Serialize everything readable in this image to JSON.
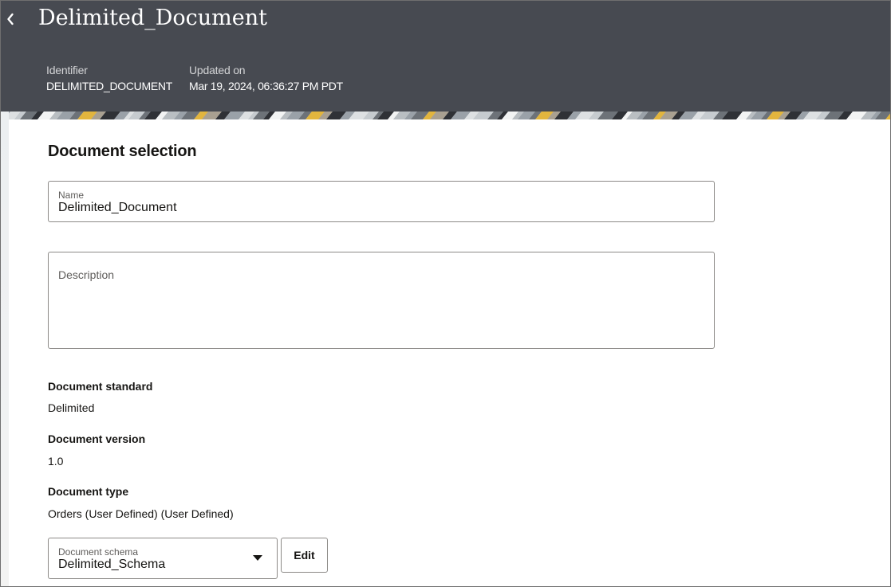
{
  "header": {
    "title": "Delimited_Document",
    "identifier_label": "Identifier",
    "identifier_value": "DELIMITED_DOCUMENT",
    "updated_label": "Updated on",
    "updated_value": "Mar 19, 2024, 06:36:27 PM PDT",
    "back_icon": "chevron-left-icon"
  },
  "section": {
    "title": "Document selection"
  },
  "form": {
    "name_label": "Name",
    "name_value": "Delimited_Document",
    "description_label": "Description",
    "description_value": "",
    "standard_label": "Document standard",
    "standard_value": "Delimited",
    "version_label": "Document version",
    "version_value": "1.0",
    "type_label": "Document type",
    "type_value": "Orders (User Defined) (User Defined)",
    "schema_label": "Document schema",
    "schema_value": "Delimited_Schema",
    "schema_icon": "caret-down-icon",
    "edit_label": "Edit"
  },
  "colors": {
    "header_bg": "#474a51",
    "accent_gold": "#e2b53e",
    "text": "#161513"
  }
}
